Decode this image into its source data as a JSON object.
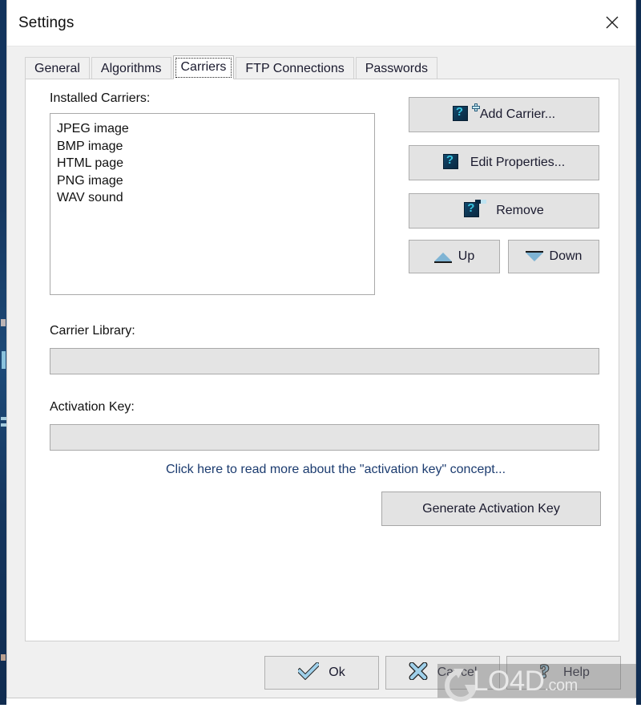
{
  "window": {
    "title": "Settings",
    "close_icon": "close-icon"
  },
  "tabs": [
    {
      "label": "General",
      "active": false
    },
    {
      "label": "Algorithms",
      "active": false
    },
    {
      "label": "Carriers",
      "active": true
    },
    {
      "label": "FTP Connections",
      "active": false
    },
    {
      "label": "Passwords",
      "active": false
    }
  ],
  "carriers_tab": {
    "installed_label": "Installed Carriers:",
    "installed_items": [
      "JPEG image",
      "BMP image",
      "HTML page",
      "PNG image",
      "WAV sound"
    ],
    "buttons": {
      "add_carrier": "Add Carrier...",
      "edit_properties": "Edit Properties...",
      "remove": "Remove",
      "up": "Up",
      "down": "Down"
    },
    "carrier_library_label": "Carrier Library:",
    "carrier_library_value": "",
    "carrier_library_placeholder": "",
    "activation_key_label": "Activation Key:",
    "activation_key_value": "",
    "activation_key_placeholder": "",
    "activation_link": "Click here to read more about the \"activation key\" concept...",
    "generate_button": "Generate Activation Key"
  },
  "footer": {
    "ok": "Ok",
    "cancel": "Cancel",
    "help": "Help"
  },
  "watermark": {
    "text": "LO4D",
    "suffix": ".com"
  },
  "colors": {
    "accent_icon_blue": "#0d3552",
    "accent_icon_cyan": "#39c6e0",
    "link": "#1b3b6f",
    "dialog_bg": "#f0f0f0",
    "panel_bg": "#ffffff",
    "field_disabled": "#e4e4e4",
    "desktop_strip": "#16375f"
  }
}
